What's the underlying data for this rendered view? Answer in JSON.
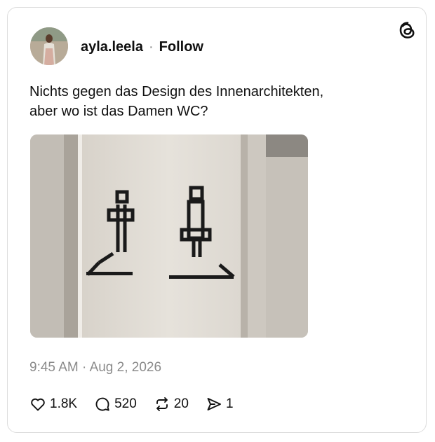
{
  "author": {
    "username": "ayla.leela",
    "separator": "·",
    "follow_label": "Follow"
  },
  "post": {
    "line1": "Nichts gegen das Design des Innenarchitekten,",
    "line2": "aber wo ist das Damen WC?"
  },
  "timestamp": {
    "time": "9:45 AM",
    "separator": "·",
    "date": "Aug 2, 2026"
  },
  "actions": {
    "likes": "1.8K",
    "replies": "520",
    "reposts": "20",
    "shares": "1"
  },
  "icons": {
    "logo": "threads-logo-icon",
    "like": "heart-icon",
    "reply": "comment-bubble-icon",
    "repost": "repost-arrows-icon",
    "share": "send-icon"
  }
}
